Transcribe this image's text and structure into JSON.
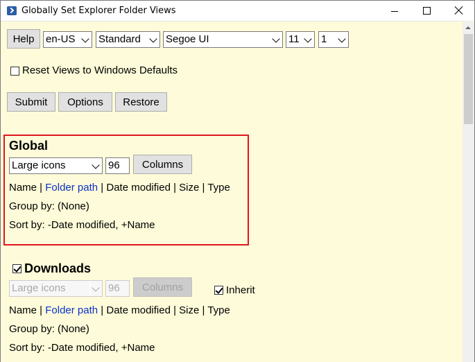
{
  "window": {
    "title": "Globally Set Explorer Folder Views"
  },
  "toolbar": {
    "help_label": "Help",
    "language": "en-US",
    "style": "Standard",
    "font": "Segoe UI",
    "font_size": "11",
    "scale": "1"
  },
  "reset": {
    "label": "Reset Views to Windows Defaults",
    "checked": false
  },
  "actions": {
    "submit": "Submit",
    "options": "Options",
    "restore": "Restore"
  },
  "global": {
    "heading": "Global",
    "view": "Large icons",
    "icon_size": "96",
    "columns_label": "Columns",
    "columns": {
      "name": "Name",
      "folder_path": "Folder path",
      "date_modified": "Date modified",
      "size": "Size",
      "type": "Type",
      "sep": " | "
    },
    "group_by": "Group by: (None)",
    "sort_by": "Sort by: -Date modified, +Name"
  },
  "downloads": {
    "heading": "Downloads",
    "checked": true,
    "view": "Large icons",
    "icon_size": "96",
    "columns_label": "Columns",
    "inherit_label": "Inherit",
    "inherit_checked": true,
    "columns": {
      "name": "Name",
      "folder_path": "Folder path",
      "date_modified": "Date modified",
      "size": "Size",
      "type": "Type",
      "sep": " | "
    },
    "group_by": "Group by: (None)",
    "sort_by": "Sort by: -Date modified, +Name"
  },
  "colors": {
    "background": "#fdfbd9",
    "highlight": "#e0141e",
    "link": "#0a31c8"
  }
}
